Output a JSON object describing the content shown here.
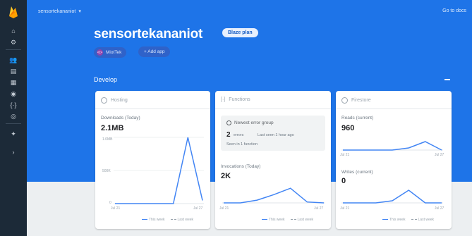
{
  "topbar": {
    "project_name": "sensortekananiot",
    "docs_link": "Go to docs"
  },
  "project": {
    "title": "sensortekananiot",
    "plan_label": "Blaze plan"
  },
  "apps": {
    "app_name": "MiotTek",
    "app_badge": "</>",
    "add_app_label": "+ Add app"
  },
  "section": {
    "title": "Develop"
  },
  "cards": {
    "hosting": {
      "header": "Hosting",
      "metric_label": "Downloads (Today)",
      "metric_value": "2.1MB",
      "y_axis": [
        "1.0MB",
        "500K",
        "0"
      ],
      "x_start": "Jul 21",
      "x_end": "Jul 27",
      "legend_this": "This week",
      "legend_last": "Last week",
      "chart_data": {
        "type": "line",
        "x": [
          "Jul 21",
          "Jul 22",
          "Jul 23",
          "Jul 24",
          "Jul 25",
          "Jul 26",
          "Jul 27"
        ],
        "series": [
          {
            "values": [
              0,
              0,
              0,
              0,
              0,
              2.1,
              0.1
            ]
          }
        ],
        "ylim": [
          0,
          2.1
        ]
      }
    },
    "functions": {
      "header": "Functions",
      "group_title": "Newest error group",
      "group_count": "2",
      "group_count_label": "errors",
      "group_last": "Last seen 1 hour ago",
      "group_see": "Seen in 1 function",
      "metric_label": "Invocations (Today)",
      "metric_value": "2K",
      "x_start": "Jul 21",
      "x_end": "Jul 27",
      "legend_this": "This week",
      "legend_last": "Last week",
      "chart_data": {
        "type": "line",
        "x": [
          "Jul 21",
          "Jul 22",
          "Jul 23",
          "Jul 24",
          "Jul 25",
          "Jul 26",
          "Jul 27"
        ],
        "series": [
          {
            "values": [
              0,
              0,
              0.3,
              0.9,
              1.6,
              0.1,
              0
            ]
          }
        ],
        "ylim": [
          0,
          2
        ]
      }
    },
    "firestore": {
      "header": "Firestore",
      "reads_label": "Reads (current)",
      "reads_value": "960",
      "writes_label": "Writes (current)",
      "writes_value": "0",
      "x_start": "Jul 21",
      "x_end": "Jul 27",
      "legend_this": "This week",
      "legend_last": "Last week",
      "chart_data": [
        {
          "type": "line",
          "x": [
            "Jul 21",
            "Jul 22",
            "Jul 23",
            "Jul 24",
            "Jul 25",
            "Jul 26",
            "Jul 27"
          ],
          "series": [
            {
              "values": [
                0,
                0,
                0,
                0,
                0.15,
                0.6,
                0
              ]
            }
          ],
          "ylim": [
            0,
            1
          ]
        },
        {
          "type": "line",
          "x": [
            "Jul 21",
            "Jul 22",
            "Jul 23",
            "Jul 24",
            "Jul 25",
            "Jul 26",
            "Jul 27"
          ],
          "series": [
            {
              "values": [
                0,
                0,
                0,
                0.15,
                0.9,
                0,
                0
              ]
            }
          ],
          "ylim": [
            0,
            1
          ]
        }
      ]
    }
  },
  "colors": {
    "hero": "#1e74e8",
    "rail": "#1c2a38",
    "line": "#4285f4"
  }
}
